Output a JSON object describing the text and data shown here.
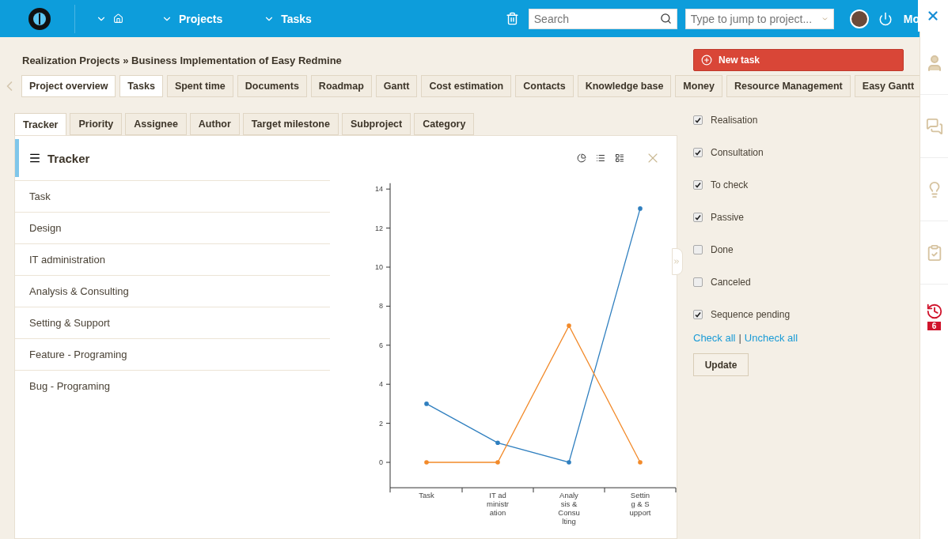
{
  "topbar": {
    "nav": [
      {
        "kind": "home"
      },
      {
        "kind": "text",
        "label": "Projects"
      },
      {
        "kind": "text",
        "label": "Tasks"
      }
    ],
    "search": {
      "placeholder": "Search"
    },
    "jump": {
      "placeholder": "Type to jump to project..."
    },
    "more_label": "Mo"
  },
  "breadcrumb": "Realization Projects » **Business Implementation of Easy Redmine**",
  "new_task_button": "New task",
  "project_tabs": [
    {
      "label": "Project overview",
      "selected": true
    },
    {
      "label": "Tasks",
      "selected": true
    },
    {
      "label": "Spent time",
      "selected": false
    },
    {
      "label": "Documents",
      "selected": false
    },
    {
      "label": "Roadmap",
      "selected": false
    },
    {
      "label": "Gantt",
      "selected": false
    },
    {
      "label": "Cost estimation",
      "selected": false
    },
    {
      "label": "Contacts",
      "selected": false
    },
    {
      "label": "Knowledge base",
      "selected": false
    },
    {
      "label": "Money",
      "selected": false
    },
    {
      "label": "Resource Management",
      "selected": false
    },
    {
      "label": "Easy Gantt",
      "selected": false
    }
  ],
  "group_tabs": [
    {
      "label": "Tracker",
      "selected": true
    },
    {
      "label": "Priority",
      "selected": false
    },
    {
      "label": "Assignee",
      "selected": false
    },
    {
      "label": "Author",
      "selected": false
    },
    {
      "label": "Target milestone",
      "selected": false
    },
    {
      "label": "Subproject",
      "selected": false
    },
    {
      "label": "Category",
      "selected": false
    }
  ],
  "panel": {
    "title": "Tracker",
    "items": [
      "Task",
      "Design",
      "IT administration",
      "Analysis & Consulting",
      "Setting & Support",
      "Feature - Programing",
      "Bug - Programing"
    ],
    "chart_data": {
      "type": "line",
      "categories": [
        "Task",
        "IT administration",
        "Analysis & Consulting",
        "Setting & Support"
      ],
      "series": [
        {
          "color": "#2f7fbf",
          "values": [
            3,
            1,
            0,
            13
          ]
        },
        {
          "color": "#f28a2a",
          "values": [
            0,
            0,
            7,
            0
          ]
        }
      ],
      "ylim": [
        -1.3,
        14.3
      ],
      "yticks": [
        0,
        2,
        4,
        6,
        8,
        10,
        12,
        14
      ]
    }
  },
  "statuses": [
    {
      "label": "Realisation",
      "checked": true
    },
    {
      "label": "Consultation",
      "checked": true
    },
    {
      "label": "To check",
      "checked": true
    },
    {
      "label": "Passive",
      "checked": true
    },
    {
      "label": "Done",
      "checked": false
    },
    {
      "label": "Canceled",
      "checked": false
    },
    {
      "label": "Sequence pending",
      "checked": true
    }
  ],
  "check_all": "Check all",
  "separator": "|",
  "uncheck_all": "Uncheck all",
  "update_button": "Update",
  "sidebar_badge": "6"
}
